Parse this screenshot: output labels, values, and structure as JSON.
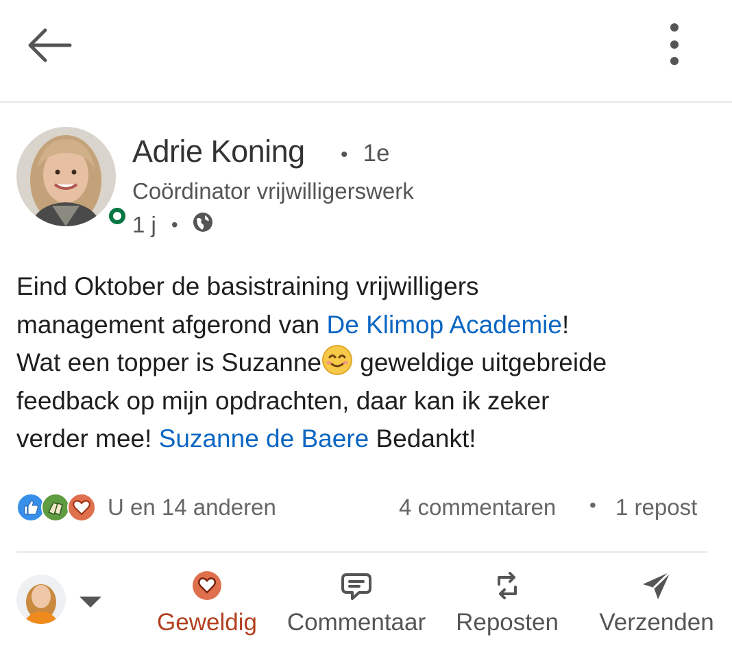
{
  "post": {
    "author": {
      "name": "Adrie Koning",
      "degree": "1e",
      "headline": "Coördinator vrijwilligerswerk",
      "time": "1 j",
      "visibility_icon": "globe-icon",
      "online_status_color": "#057642"
    },
    "body": {
      "line1": "Eind Oktober de basistraining vrijwilligers",
      "line2_text": "management afgerond van ",
      "line2_link": "De Klimop Academie",
      "line2_end": "!",
      "line3_start": "Wat een topper is Suzanne",
      "line3_emoji": "smiling-face-emoji",
      "line3_end": " geweldige uitgebreide",
      "line4": "feedback op mijn opdrachten, daar kan ik zeker",
      "line5_start": "verder mee! ",
      "line5_link": "Suzanne de Baere",
      "line5_end": " Bedankt!"
    },
    "social": {
      "reactions_text": "U en 14 anderen",
      "reaction_icons": [
        "like-icon",
        "celebrate-icon",
        "love-icon"
      ],
      "comments_text": "4 commentaren",
      "reposts_text": "1 repost"
    }
  },
  "actions": {
    "like": "Geweldig",
    "comment": "Commentaar",
    "repost": "Reposten",
    "send": "Verzenden"
  },
  "colors": {
    "link": "#0a66c2",
    "active_reaction": "#b24020",
    "like_blue": "#378fe9",
    "celebrate_green": "#5f9b41",
    "love_orange": "#df704d"
  }
}
